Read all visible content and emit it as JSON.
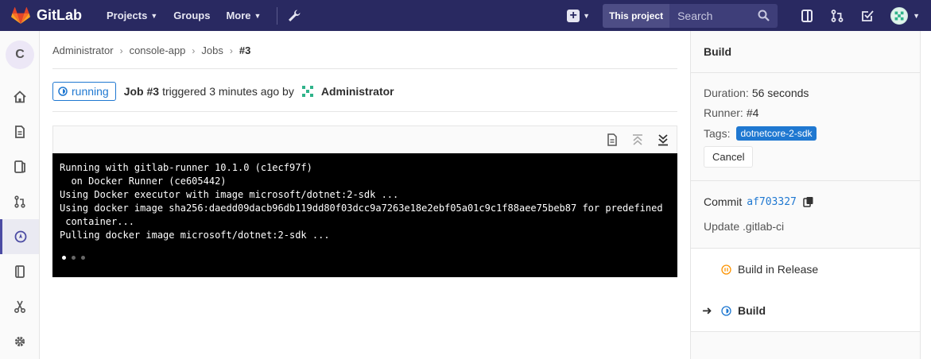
{
  "navbar": {
    "brand": "GitLab",
    "projects": "Projects",
    "groups": "Groups",
    "more": "More",
    "this_project": "This project",
    "search_placeholder": "Search"
  },
  "sidebar": {
    "project_avatar_letter": "C"
  },
  "breadcrumb": {
    "items": [
      "Administrator",
      "console-app",
      "Jobs"
    ],
    "current": "#3"
  },
  "job": {
    "status": "running",
    "title": "Job #3",
    "triggered_text": "triggered 3 minutes ago by",
    "user": "Administrator"
  },
  "log": {
    "lines": [
      "Running with gitlab-runner 10.1.0 (c1ecf97f)",
      "  on Docker Runner (ce605442)",
      "Using Docker executor with image microsoft/dotnet:2-sdk ...",
      "Using docker image sha256:daedd09dacb96db119dd80f03dcc9a7263e18e2ebf05a01c9c1f88aee75beb87 for predefined",
      " container...",
      "Pulling docker image microsoft/dotnet:2-sdk ..."
    ]
  },
  "right": {
    "title": "Build",
    "duration_label": "Duration:",
    "duration_value": "56 seconds",
    "runner_label": "Runner:",
    "runner_value": "#4",
    "tags_label": "Tags:",
    "tag": "dotnetcore-2-sdk",
    "cancel": "Cancel",
    "commit_label": "Commit",
    "commit_sha": "af703327",
    "commit_message": "Update .gitlab-ci",
    "jobs": [
      {
        "name": "Build in Release",
        "status": "pending"
      },
      {
        "name": "Build",
        "status": "running",
        "current": true
      }
    ]
  },
  "colors": {
    "navbar": "#292961",
    "accent": "#1f78d1",
    "pending": "#fc9403"
  }
}
